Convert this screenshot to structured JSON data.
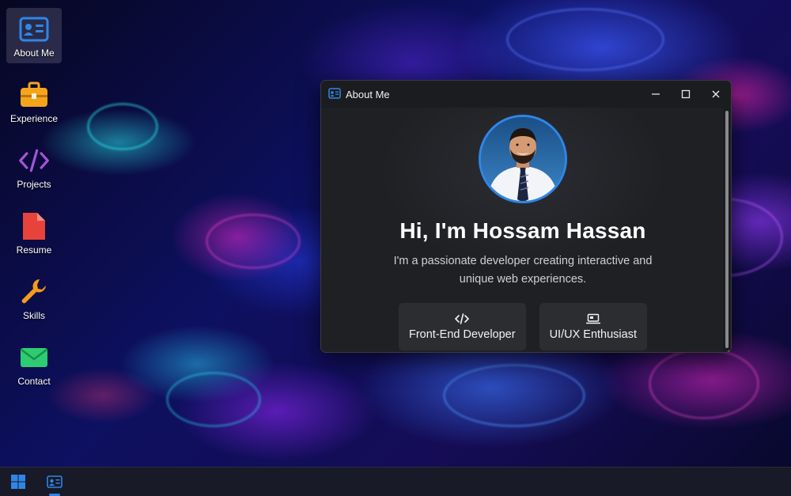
{
  "desktop": {
    "icons": [
      {
        "label": "About Me",
        "icon": "contact-card-icon",
        "selected": true
      },
      {
        "label": "Experience",
        "icon": "briefcase-icon"
      },
      {
        "label": "Projects",
        "icon": "code-icon"
      },
      {
        "label": "Resume",
        "icon": "pdf-file-icon"
      },
      {
        "label": "Skills",
        "icon": "wrench-icon"
      },
      {
        "label": "Contact",
        "icon": "envelope-icon"
      }
    ]
  },
  "window": {
    "title": "About Me",
    "heading": "Hi, I'm Hossam Hassan",
    "bio": "I'm a passionate developer creating interactive and unique web experiences.",
    "roles": [
      {
        "label": "Front-End Developer",
        "icon": "code-icon"
      },
      {
        "label": "UI/UX Enthusiast",
        "icon": "laptop-icon"
      }
    ]
  },
  "taskbar": {
    "start_icon": "windows-logo-icon",
    "apps": [
      {
        "icon": "contact-card-icon",
        "active": true
      }
    ]
  },
  "colors": {
    "accent": "#2f86e8",
    "briefcase": "#f5a51c",
    "code": "#a354d6",
    "pdf": "#e8433a",
    "wrench": "#f59a1c",
    "envelope": "#2ecc71"
  }
}
